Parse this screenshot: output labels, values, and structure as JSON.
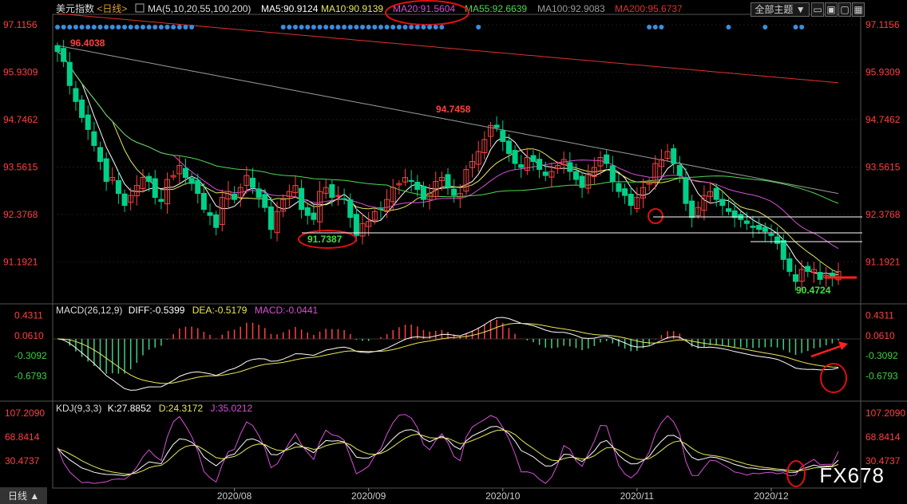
{
  "header": {
    "symbol": "美元指数",
    "period": "<日线>",
    "ma_prefix": "MA(5,10,20,55,100,200)",
    "ma5": "MA5:90.9124",
    "ma10": "MA10:90.9139",
    "ma20": "MA20:91.5604",
    "ma55": "MA55:92.6639",
    "ma100": "MA100:92.9083",
    "ma200": "MA200:95.6737",
    "theme_button": "全部主题",
    "colors": {
      "ma5": "#ffffff",
      "ma10": "#e8e85a",
      "ma20": "#d94fd9",
      "ma55": "#4fd94f",
      "ma100": "#9a9a9a",
      "ma200": "#e03030"
    }
  },
  "macd_header": {
    "label": "MACD(26,12,9)",
    "diff": "DIFF:-0.5399",
    "dea": "DEA:-0.5179",
    "macd": "MACD:-0.0441"
  },
  "kdj_header": {
    "label": "KDJ(9,3,3)",
    "k": "K:27.8852",
    "d": "D:24.3172",
    "j": "J:35.0212"
  },
  "bottom_tab": "日线",
  "watermark": "FX678",
  "chart_data": {
    "type": "candlestick",
    "price_axis": {
      "ticks": [
        "97.1156",
        "95.9309",
        "94.7462",
        "93.5615",
        "92.3768",
        "91.1921"
      ],
      "ylim": [
        90.2,
        97.3
      ]
    },
    "macd_axis": {
      "ticks": [
        "0.4311",
        "0.0610",
        "-0.3092",
        "-0.6793"
      ],
      "ylim": [
        -1.1,
        0.6
      ]
    },
    "kdj_axis": {
      "ticks": [
        "107.2090",
        "68.8414",
        "30.4737"
      ],
      "ylim": [
        -10,
        120
      ]
    },
    "x_ticks": [
      {
        "label": "2020/08",
        "index": 29
      },
      {
        "label": "2020/09",
        "index": 51
      },
      {
        "label": "2020/10",
        "index": 73
      },
      {
        "label": "2020/11",
        "index": 95
      },
      {
        "label": "2020/12",
        "index": 117
      }
    ],
    "annotations": {
      "high_start": "96.4038",
      "high_mid": "94.7458",
      "low_sep": "91.7387",
      "low_end": "90.4724"
    },
    "closes": [
      96.45,
      96.2,
      95.6,
      95.2,
      94.8,
      94.5,
      94.1,
      93.7,
      93.2,
      93.3,
      92.9,
      92.6,
      92.85,
      93.1,
      93.3,
      93.2,
      92.8,
      92.7,
      93.25,
      93.35,
      93.6,
      93.3,
      93.15,
      92.9,
      92.5,
      92.35,
      92.05,
      92.8,
      92.95,
      92.75,
      93.05,
      93.35,
      93.05,
      92.8,
      92.55,
      92.0,
      92.45,
      92.75,
      92.95,
      93.1,
      92.5,
      92.35,
      92.25,
      92.95,
      93.05,
      92.8,
      92.85,
      92.75,
      92.3,
      91.85,
      92.15,
      92.2,
      92.45,
      92.5,
      92.75,
      93.05,
      93.15,
      93.3,
      93.2,
      93.0,
      92.75,
      92.9,
      93.2,
      93.3,
      93.05,
      92.85,
      92.9,
      93.5,
      93.7,
      93.95,
      94.25,
      94.6,
      94.55,
      94.2,
      93.9,
      93.65,
      93.55,
      93.8,
      93.7,
      93.5,
      93.35,
      93.45,
      93.6,
      93.75,
      93.45,
      93.25,
      93.05,
      93.4,
      93.55,
      93.8,
      93.65,
      93.2,
      92.95,
      92.85,
      92.6,
      92.8,
      93.05,
      93.2,
      93.65,
      93.75,
      93.95,
      93.65,
      93.35,
      92.65,
      92.3,
      92.55,
      92.85,
      92.95,
      92.75,
      92.6,
      92.45,
      92.3,
      92.25,
      92.15,
      92.05,
      92.0,
      91.95,
      91.85,
      91.65,
      91.25,
      90.95,
      90.7,
      91.0,
      90.95,
      91.0,
      90.75,
      90.85,
      90.8,
      90.95
    ]
  }
}
